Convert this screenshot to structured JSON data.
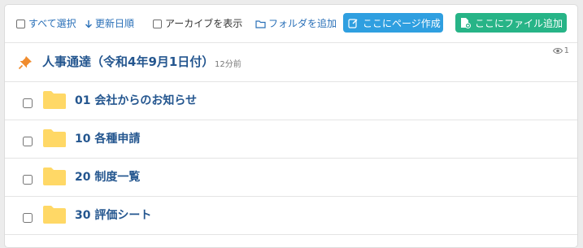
{
  "toolbar": {
    "select_all": "すべて選択",
    "sort_updated": "更新日順",
    "show_archive": "アーカイブを表示",
    "add_folder": "フォルダを追加",
    "create_page": "ここにページ作成",
    "add_file": "ここにファイル追加"
  },
  "pinned": {
    "title": "人事通達（令和4年9月1日付）",
    "time": "12分前",
    "views": "1"
  },
  "folders": [
    {
      "label": "01 会社からのお知らせ"
    },
    {
      "label": "10 各種申請"
    },
    {
      "label": "20 制度一覧"
    },
    {
      "label": "30 評価シート"
    }
  ],
  "colors": {
    "link": "#2a70b8",
    "title": "#24568f",
    "btn_create": "#2f9fe0",
    "btn_file": "#27b487",
    "folder": "#ffd866",
    "pin": "#f08c2e"
  },
  "icons": [
    "arrow-down-icon",
    "folder-outline-icon",
    "edit-icon",
    "file-add-icon",
    "pin-icon",
    "eye-icon",
    "folder-icon"
  ]
}
